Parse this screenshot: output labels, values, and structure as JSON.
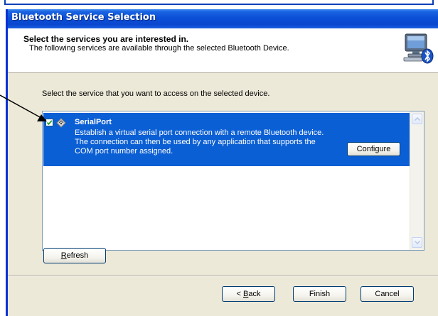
{
  "window": {
    "title": "Bluetooth Service Selection"
  },
  "header": {
    "title": "Select the services you are interested in.",
    "subtitle": "The following services are available through the selected Bluetooth Device.",
    "icon": "computer-bluetooth-icon"
  },
  "instruction": "Select the service that you want to access on the selected device.",
  "services": [
    {
      "name": "SerialPort",
      "checked": true,
      "icon": "serial-port-icon",
      "description": [
        "Establish a virtual serial port connection with a remote Bluetooth device.",
        "The connection can then be used by any application that supports the",
        "COM port number assigned."
      ],
      "configure_label": "Configure"
    }
  ],
  "buttons": {
    "refresh_accel": "R",
    "refresh_rest": "efresh",
    "back_prefix": "< ",
    "back_accel": "B",
    "back_rest": "ack",
    "finish": "Finish",
    "cancel": "Cancel"
  },
  "colors": {
    "titlebar": "#0b4fd6",
    "selection": "#0b5fd4",
    "dialog_bg": "#ece9d8"
  }
}
